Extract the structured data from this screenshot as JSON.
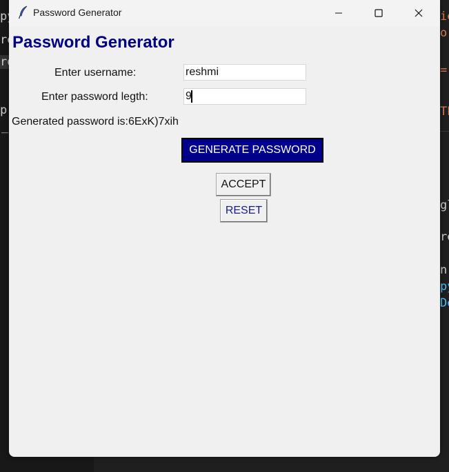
{
  "window": {
    "title": "Password Generator"
  },
  "app": {
    "heading": "Password Generator",
    "username_label": "Enter username:",
    "username_value": "reshmi",
    "length_label": "Enter password legth:",
    "length_value": "9",
    "generated_text": "Generated password is:6ExK)7xih",
    "generate_button": "GENERATE PASSWORD",
    "accept_button": "ACCEPT",
    "reset_button": "RESET"
  },
  "background_editor": {
    "fragments_left": [
      "py",
      "re",
      "rd",
      "p",
      "_"
    ],
    "fragments_right": [
      "ie",
      "or",
      "=\"",
      "TE",
      "gl",
      "re",
      "n",
      "py",
      "De"
    ]
  },
  "colors": {
    "heading": "#000080",
    "generate_button_bg": "#00008b",
    "window_bg": "#f0f0f0",
    "editor_bg": "#1f1f1f"
  },
  "icons": {
    "window_icon": "feather-icon",
    "minimize": "minimize-icon",
    "maximize": "maximize-icon",
    "close": "close-icon"
  }
}
